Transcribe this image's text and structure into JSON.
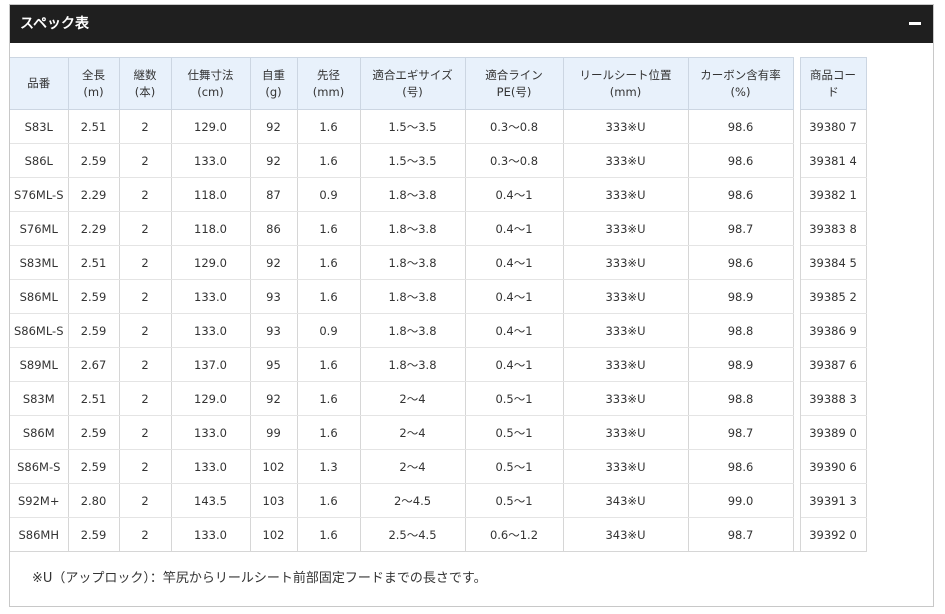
{
  "panel": {
    "title": "スペック表",
    "collapse_icon": "minus-icon"
  },
  "table": {
    "headers": [
      "品番",
      "全長\n(m)",
      "継数\n(本)",
      "仕舞寸法\n(cm)",
      "自重\n(g)",
      "先径\n(mm)",
      "適合エギサイズ\n(号)",
      "適合ライン\nPE(号)",
      "リールシート位置\n(mm)",
      "カーボン含有率\n(%)",
      "商品コー\nド"
    ],
    "rows": [
      [
        "S83L",
        "2.51",
        "2",
        "129.0",
        "92",
        "1.6",
        "1.5～3.5",
        "0.3～0.8",
        "333※U",
        "98.6",
        "39380 7"
      ],
      [
        "S86L",
        "2.59",
        "2",
        "133.0",
        "92",
        "1.6",
        "1.5～3.5",
        "0.3～0.8",
        "333※U",
        "98.6",
        "39381 4"
      ],
      [
        "S76ML-S",
        "2.29",
        "2",
        "118.0",
        "87",
        "0.9",
        "1.8～3.8",
        "0.4～1",
        "333※U",
        "98.6",
        "39382 1"
      ],
      [
        "S76ML",
        "2.29",
        "2",
        "118.0",
        "86",
        "1.6",
        "1.8～3.8",
        "0.4～1",
        "333※U",
        "98.7",
        "39383 8"
      ],
      [
        "S83ML",
        "2.51",
        "2",
        "129.0",
        "92",
        "1.6",
        "1.8～3.8",
        "0.4～1",
        "333※U",
        "98.6",
        "39384 5"
      ],
      [
        "S86ML",
        "2.59",
        "2",
        "133.0",
        "93",
        "1.6",
        "1.8～3.8",
        "0.4～1",
        "333※U",
        "98.9",
        "39385 2"
      ],
      [
        "S86ML-S",
        "2.59",
        "2",
        "133.0",
        "93",
        "0.9",
        "1.8～3.8",
        "0.4～1",
        "333※U",
        "98.8",
        "39386 9"
      ],
      [
        "S89ML",
        "2.67",
        "2",
        "137.0",
        "95",
        "1.6",
        "1.8～3.8",
        "0.4～1",
        "333※U",
        "98.9",
        "39387 6"
      ],
      [
        "S83M",
        "2.51",
        "2",
        "129.0",
        "92",
        "1.6",
        "2～4",
        "0.5～1",
        "333※U",
        "98.8",
        "39388 3"
      ],
      [
        "S86M",
        "2.59",
        "2",
        "133.0",
        "99",
        "1.6",
        "2～4",
        "0.5～1",
        "333※U",
        "98.7",
        "39389 0"
      ],
      [
        "S86M-S",
        "2.59",
        "2",
        "133.0",
        "102",
        "1.3",
        "2～4",
        "0.5～1",
        "333※U",
        "98.6",
        "39390 6"
      ],
      [
        "S92M+",
        "2.80",
        "2",
        "143.5",
        "103",
        "1.6",
        "2～4.5",
        "0.5～1",
        "343※U",
        "99.0",
        "39391 3"
      ],
      [
        "S86MH",
        "2.59",
        "2",
        "133.0",
        "102",
        "1.6",
        "2.5～4.5",
        "0.6～1.2",
        "343※U",
        "98.7",
        "39392 0"
      ]
    ]
  },
  "footnote": "※U（アップロック）：竿尻からリールシート前部固定フードまでの長さです。",
  "colors": {
    "header_bar": "#1f1f1f",
    "table_header_bg": "#e8f1fb"
  }
}
